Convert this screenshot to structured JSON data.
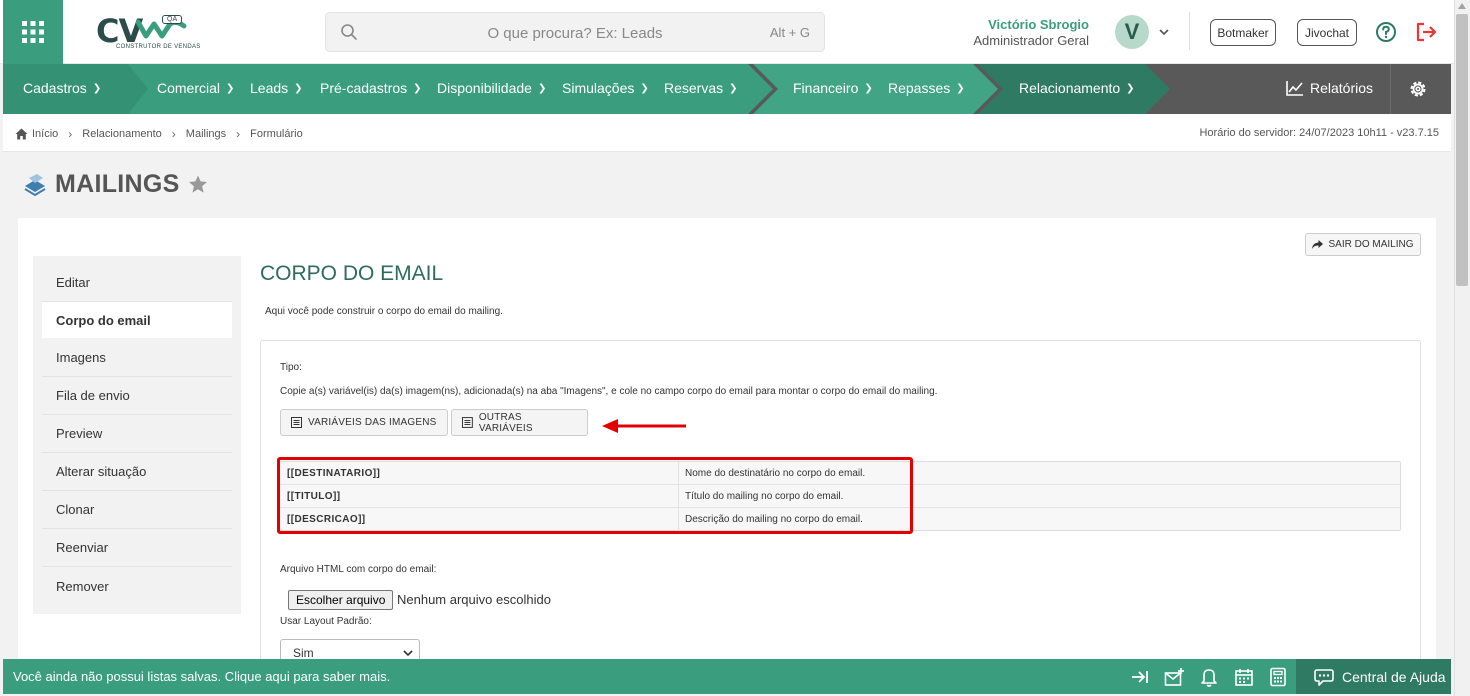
{
  "app": {
    "logo_text": "CV",
    "logo_badge": "QA",
    "logo_subtitle": "CONSTRUTOR DE VENDAS"
  },
  "search": {
    "placeholder": "O que procura? Ex: Leads",
    "shortcut": "Alt + G"
  },
  "user": {
    "name": "Victório Sbrogio",
    "role": "Administrador Geral",
    "avatar_initial": "V"
  },
  "top_buttons": {
    "botmaker": "Botmaker",
    "jivochat": "Jivochat"
  },
  "nav": {
    "items": [
      {
        "label": "Cadastros"
      },
      {
        "label": "Comercial"
      },
      {
        "label": "Leads"
      },
      {
        "label": "Pré-cadastros"
      },
      {
        "label": "Disponibilidade"
      },
      {
        "label": "Simulações"
      },
      {
        "label": "Reservas"
      },
      {
        "label": "Financeiro"
      },
      {
        "label": "Repasses"
      },
      {
        "label": "Relacionamento"
      }
    ],
    "reports": "Relatórios"
  },
  "breadcrumb": {
    "items": [
      "Início",
      "Relacionamento",
      "Mailings",
      "Formulário"
    ],
    "server_time": "Horário do servidor: 24/07/2023 10h11 - v23.7.15"
  },
  "page": {
    "title": "MAILINGS"
  },
  "sidebar": {
    "items": [
      {
        "label": "Editar"
      },
      {
        "label": "Corpo do email"
      },
      {
        "label": "Imagens"
      },
      {
        "label": "Fila de envio"
      },
      {
        "label": "Preview"
      },
      {
        "label": "Alterar situação"
      },
      {
        "label": "Clonar"
      },
      {
        "label": "Reenviar"
      },
      {
        "label": "Remover"
      }
    ],
    "active_index": 1
  },
  "section": {
    "exit_button": "SAIR DO MAILING",
    "title": "CORPO DO EMAIL",
    "description": "Aqui você pode construir o corpo do email do mailing.",
    "tipo_label": "Tipo:",
    "copy_instructions": "Copie a(s) variável(is) da(s) imagem(ns), adicionada(s) na aba \"Imagens\", e cole no campo corpo do email para montar o corpo do email do mailing.",
    "btn_image_vars": "VARIÁVEIS DAS IMAGENS",
    "btn_other_vars": "OUTRAS VARIÁVEIS",
    "variables": [
      {
        "key": "[[DESTINATARIO]]",
        "desc": "Nome do destinatário no corpo do email."
      },
      {
        "key": "[[TITULO]]",
        "desc": "Título do mailing no corpo do email."
      },
      {
        "key": "[[DESCRICAO]]",
        "desc": "Descrição do mailing no corpo do email."
      }
    ],
    "html_file_label": "Arquivo HTML com corpo do email:",
    "file_button": "Escolher arquivo",
    "file_status": "Nenhum arquivo escolhido",
    "layout_label": "Usar Layout Padrão:",
    "layout_value": "Sim"
  },
  "bottom": {
    "message": "Você ainda não possui listas salvas. Clique aqui para saber mais.",
    "help_center": "Central de Ajuda"
  },
  "colors": {
    "brand_green": "#3a9e7e",
    "dark_green": "#2f7a62",
    "nav_gray": "#595959",
    "highlight_red": "#e30000"
  }
}
